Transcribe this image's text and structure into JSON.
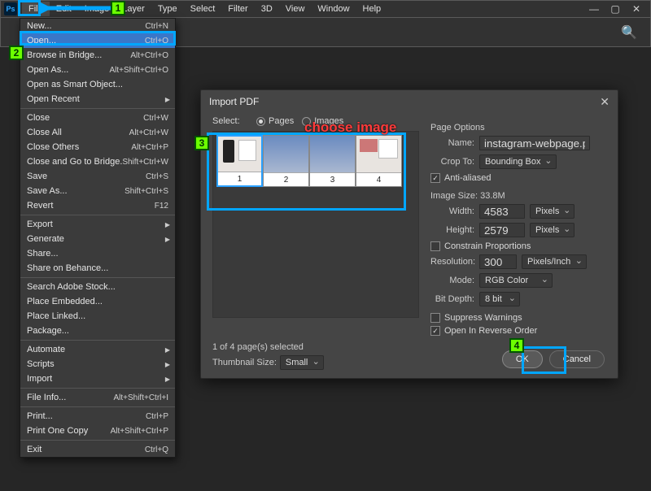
{
  "app": {
    "logo_text": "Ps"
  },
  "menubar": [
    "File",
    "Edit",
    "Image",
    "Layer",
    "Type",
    "Select",
    "Filter",
    "3D",
    "View",
    "Window",
    "Help"
  ],
  "dropdown": {
    "groups": [
      [
        {
          "label": "New...",
          "shortcut": "Ctrl+N"
        },
        {
          "label": "Open...",
          "shortcut": "Ctrl+O",
          "highlight": true
        },
        {
          "label": "Browse in Bridge...",
          "shortcut": "Alt+Ctrl+O"
        },
        {
          "label": "Open As...",
          "shortcut": "Alt+Shift+Ctrl+O"
        },
        {
          "label": "Open as Smart Object..."
        },
        {
          "label": "Open Recent",
          "submenu": true
        }
      ],
      [
        {
          "label": "Close",
          "shortcut": "Ctrl+W"
        },
        {
          "label": "Close All",
          "shortcut": "Alt+Ctrl+W"
        },
        {
          "label": "Close Others",
          "shortcut": "Alt+Ctrl+P"
        },
        {
          "label": "Close and Go to Bridge...",
          "shortcut": "Shift+Ctrl+W"
        },
        {
          "label": "Save",
          "shortcut": "Ctrl+S"
        },
        {
          "label": "Save As...",
          "shortcut": "Shift+Ctrl+S"
        },
        {
          "label": "Revert",
          "shortcut": "F12"
        }
      ],
      [
        {
          "label": "Export",
          "submenu": true
        },
        {
          "label": "Generate",
          "submenu": true
        },
        {
          "label": "Share..."
        },
        {
          "label": "Share on Behance..."
        }
      ],
      [
        {
          "label": "Search Adobe Stock..."
        },
        {
          "label": "Place Embedded..."
        },
        {
          "label": "Place Linked..."
        },
        {
          "label": "Package..."
        }
      ],
      [
        {
          "label": "Automate",
          "submenu": true
        },
        {
          "label": "Scripts",
          "submenu": true
        },
        {
          "label": "Import",
          "submenu": true
        }
      ],
      [
        {
          "label": "File Info...",
          "shortcut": "Alt+Shift+Ctrl+I"
        }
      ],
      [
        {
          "label": "Print...",
          "shortcut": "Ctrl+P"
        },
        {
          "label": "Print One Copy",
          "shortcut": "Alt+Shift+Ctrl+P"
        }
      ],
      [
        {
          "label": "Exit",
          "shortcut": "Ctrl+Q"
        }
      ]
    ]
  },
  "dialog": {
    "title": "Import PDF",
    "select_label": "Select:",
    "radio_pages": "Pages",
    "radio_images": "Images",
    "thumbs": [
      "1",
      "2",
      "3",
      "4"
    ],
    "selected_info": "1 of 4 page(s) selected",
    "thumb_size_label": "Thumbnail Size:",
    "thumb_size_value": "Small",
    "page_options_label": "Page Options",
    "name_label": "Name:",
    "name_value": "instagram-webpage.pdf",
    "crop_label": "Crop To:",
    "crop_value": "Bounding Box",
    "anti_aliased": "Anti-aliased",
    "image_size_label": "Image Size: 33.8M",
    "width_label": "Width:",
    "width_value": "4583",
    "width_unit": "Pixels",
    "height_label": "Height:",
    "height_value": "2579",
    "height_unit": "Pixels",
    "constrain": "Constrain Proportions",
    "res_label": "Resolution:",
    "res_value": "300",
    "res_unit": "Pixels/Inch",
    "mode_label": "Mode:",
    "mode_value": "RGB Color",
    "depth_label": "Bit Depth:",
    "depth_value": "8 bit",
    "suppress": "Suppress Warnings",
    "reverse": "Open In Reverse Order",
    "ok": "OK",
    "cancel": "Cancel"
  },
  "annotations": {
    "steps": {
      "1": "1",
      "2": "2",
      "3": "3",
      "4": "4"
    },
    "choose_image": "choose image"
  }
}
